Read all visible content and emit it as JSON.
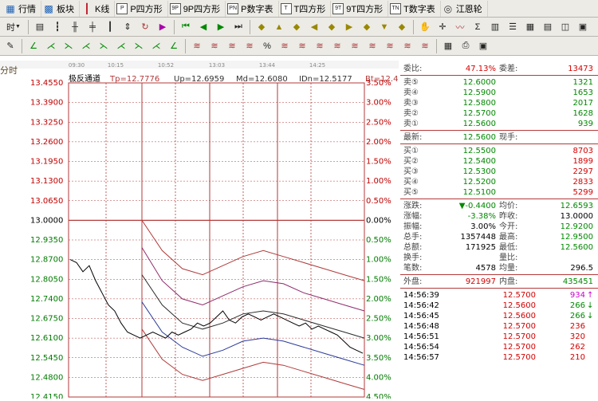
{
  "menubar": [
    {
      "label": "行情",
      "icon": "grid-icon"
    },
    {
      "label": "板块",
      "icon": "blocks-icon"
    },
    {
      "label": "K线",
      "icon": "candle-icon"
    },
    {
      "label": "P四方形",
      "icon": "p-square-icon"
    },
    {
      "label": "9P四方形",
      "icon": "9p-square-icon"
    },
    {
      "label": "P数字表",
      "icon": "p-table-icon"
    },
    {
      "label": "T四方形",
      "icon": "t-square-icon"
    },
    {
      "label": "9T四方形",
      "icon": "9t-square-icon"
    },
    {
      "label": "T数字表",
      "icon": "t-table-icon"
    },
    {
      "label": "江恩轮",
      "icon": "gann-wheel-icon"
    }
  ],
  "toolbar1": {
    "period_label": "时"
  },
  "chart_header": {
    "mode_label": "分时",
    "indicator_name": "极反通道",
    "tp": "Tp=12.7776",
    "up": "Up=12.6959",
    "md": "Md=12.6080",
    "dn": "IDn=12.5177",
    "bt": "Bt=12.4360"
  },
  "time_labels": [
    "09:30",
    "10:15",
    "10:52",
    "13:03",
    "13:44",
    "14:25"
  ],
  "chart_data": {
    "type": "line",
    "yticks_price": [
      "13.4550",
      "13.3900",
      "13.3250",
      "13.2600",
      "13.1950",
      "13.1300",
      "13.0650",
      "13.0000",
      "12.9350",
      "12.8700",
      "12.8050",
      "12.7400",
      "12.6750",
      "12.6100",
      "12.5450",
      "12.4800",
      "12.4150"
    ],
    "yticks_pct": [
      "3.50%",
      "3.00%",
      "2.50%",
      "2.00%",
      "1.50%",
      "1.00%",
      "0.50%",
      "0.00%",
      "0.50%",
      "1.00%",
      "1.50%",
      "2.00%",
      "2.50%",
      "3.00%",
      "3.50%",
      "4.00%",
      "4.50%"
    ],
    "ylim": [
      12.415,
      13.455
    ],
    "prev_close": 13.0,
    "price_series": [
      12.87,
      12.86,
      12.83,
      12.85,
      12.8,
      12.76,
      12.72,
      12.7,
      12.66,
      12.63,
      12.62,
      12.61,
      12.62,
      12.63,
      12.62,
      12.61,
      12.63,
      12.62,
      12.63,
      12.64,
      12.66,
      12.65,
      12.66,
      12.68,
      12.7,
      12.67,
      12.66,
      12.68,
      12.69,
      12.68,
      12.67,
      12.68,
      12.69,
      12.68,
      12.67,
      12.66,
      12.65,
      12.66,
      12.64,
      12.65,
      12.64,
      12.63,
      12.62,
      12.6,
      12.58,
      12.57,
      12.56
    ],
    "channel_series": [
      {
        "color": "#b03a3a",
        "values": [
          13.0,
          12.9,
          12.84,
          12.82,
          12.85,
          12.88,
          12.9,
          12.88,
          12.86,
          12.84,
          12.82,
          12.8
        ]
      },
      {
        "color": "#8e2a6a",
        "values": [
          12.91,
          12.8,
          12.74,
          12.72,
          12.75,
          12.78,
          12.8,
          12.79,
          12.76,
          12.74,
          12.72,
          12.7
        ]
      },
      {
        "color": "#2a2a2a",
        "values": [
          12.82,
          12.72,
          12.66,
          12.64,
          12.66,
          12.69,
          12.7,
          12.69,
          12.67,
          12.65,
          12.63,
          12.61
        ]
      },
      {
        "color": "#2a3a9a",
        "values": [
          12.73,
          12.63,
          12.58,
          12.55,
          12.57,
          12.6,
          12.61,
          12.6,
          12.58,
          12.56,
          12.54,
          12.52
        ]
      },
      {
        "color": "#b03a3a",
        "values": [
          12.64,
          12.54,
          12.49,
          12.47,
          12.49,
          12.51,
          12.53,
          12.52,
          12.5,
          12.48,
          12.46,
          12.44
        ]
      }
    ],
    "vertical_grid_times": [
      "09:30",
      "10:15",
      "10:52",
      "13:03",
      "13:44",
      "14:25"
    ]
  },
  "quote": {
    "weibi_label": "委比:",
    "weibi_value": "47.13%",
    "weicha_label": "委差:",
    "weicha_value": "13473",
    "asks": [
      {
        "label": "卖⑤",
        "price": "12.6000",
        "vol": "1321"
      },
      {
        "label": "卖④",
        "price": "12.5900",
        "vol": "1653"
      },
      {
        "label": "卖③",
        "price": "12.5800",
        "vol": "2017"
      },
      {
        "label": "卖②",
        "price": "12.5700",
        "vol": "1628"
      },
      {
        "label": "卖①",
        "price": "12.5600",
        "vol": "939"
      }
    ],
    "last_label": "最新:",
    "last_value": "12.5600",
    "xianshou_label": "现手:",
    "xianshou_value": "",
    "bids": [
      {
        "label": "买①",
        "price": "12.5500",
        "vol": "8703"
      },
      {
        "label": "买②",
        "price": "12.5400",
        "vol": "1899"
      },
      {
        "label": "买③",
        "price": "12.5300",
        "vol": "2297"
      },
      {
        "label": "买④",
        "price": "12.5200",
        "vol": "2833"
      },
      {
        "label": "买⑤",
        "price": "12.5100",
        "vol": "5299"
      }
    ],
    "stats": [
      {
        "l1": "涨跌:",
        "v1": "▼-0.4400",
        "l2": "均价:",
        "v2": "12.6593",
        "c1": "green",
        "c2": "green"
      },
      {
        "l1": "涨幅:",
        "v1": "-3.38%",
        "l2": "昨收:",
        "v2": "13.0000",
        "c1": "green",
        "c2": "black"
      },
      {
        "l1": "振幅:",
        "v1": "3.00%",
        "l2": "今开:",
        "v2": "12.9200",
        "c1": "black",
        "c2": "green"
      },
      {
        "l1": "总手:",
        "v1": "1357448",
        "l2": "最高:",
        "v2": "12.9500",
        "c1": "black",
        "c2": "green"
      },
      {
        "l1": "总额:",
        "v1": "171925",
        "l2": "最低:",
        "v2": "12.5600",
        "c1": "black",
        "c2": "green"
      },
      {
        "l1": "换手:",
        "v1": "",
        "l2": "量比:",
        "v2": "",
        "c1": "black",
        "c2": "black"
      },
      {
        "l1": "笔数:",
        "v1": "4578",
        "l2": "均量:",
        "v2": "296.5",
        "c1": "black",
        "c2": "black"
      }
    ],
    "waipan_label": "外盘:",
    "waipan_value": "921997",
    "neipan_label": "内盘:",
    "neipan_value": "435451",
    "ticks": [
      {
        "time": "14:56:39",
        "price": "12.5700",
        "vol": "934",
        "dir": "↑",
        "vc": "mag"
      },
      {
        "time": "14:56:42",
        "price": "12.5600",
        "vol": "266",
        "dir": "↓",
        "vc": "green"
      },
      {
        "time": "14:56:45",
        "price": "12.5600",
        "vol": "266",
        "dir": "↓",
        "vc": "green"
      },
      {
        "time": "14:56:48",
        "price": "12.5700",
        "vol": "236",
        "dir": "",
        "vc": "red"
      },
      {
        "time": "14:56:51",
        "price": "12.5700",
        "vol": "320",
        "dir": "",
        "vc": "red"
      },
      {
        "time": "14:56:54",
        "price": "12.5700",
        "vol": "262",
        "dir": "",
        "vc": "red"
      },
      {
        "time": "14:56:57",
        "price": "12.5700",
        "vol": "210",
        "dir": "",
        "vc": "red"
      }
    ]
  },
  "colors": {
    "up": "#d40000",
    "down": "#008800",
    "grid": "#b43a3a",
    "price_line": "#000000"
  }
}
